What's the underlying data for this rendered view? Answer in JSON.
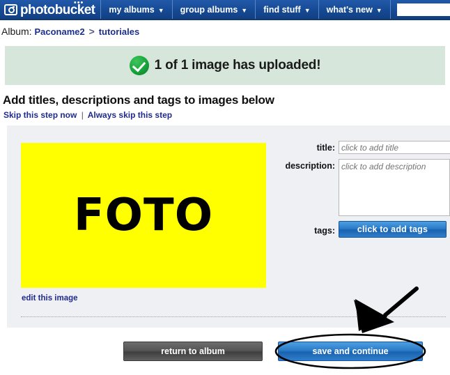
{
  "nav": {
    "logo_text": "photobucket",
    "logo_dots": "•••",
    "items": [
      {
        "label": "my albums",
        "caret": "▼"
      },
      {
        "label": "group albums",
        "caret": "▼"
      },
      {
        "label": "find stuff",
        "caret": "▼"
      },
      {
        "label": "what's new",
        "caret": "▼"
      }
    ],
    "search_value": "",
    "search_placeholder": ""
  },
  "breadcrumb": {
    "label": "Album:",
    "root": "Paconame2",
    "separator": ">",
    "current": "tutoriales"
  },
  "banner": {
    "icon": "green-check-icon",
    "text": "1 of 1 image has uploaded!",
    "bg_color": "#d6e6da",
    "check_color": "#18a33b"
  },
  "section": {
    "heading": "Add titles, descriptions and tags to images below",
    "skip_now": "Skip this step now",
    "pipe": "|",
    "skip_always": "Always skip this step"
  },
  "panel": {
    "thumbnail": {
      "text": "FOTO",
      "bg_color": "#ffff00",
      "text_color": "#000000"
    },
    "edit_link": "edit this image",
    "form": {
      "title_label": "title:",
      "title_value": "",
      "title_placeholder": "click to add title",
      "description_label": "description:",
      "description_value": "",
      "description_placeholder": "click to add description",
      "tags_label": "tags:",
      "tags_button": "click to add tags"
    }
  },
  "footer": {
    "return_label": "return to album",
    "save_label": "save and continue"
  },
  "annotations": {
    "arrow": "black-arrow-pointing-down-left",
    "ellipse": "black-ellipse-highlight-around-save-button"
  },
  "colors": {
    "nav_blue": "#1a4f9c",
    "link_blue": "#1f2a8c",
    "button_blue": "#2a7bc8",
    "panel_bg": "#eef0f4"
  }
}
